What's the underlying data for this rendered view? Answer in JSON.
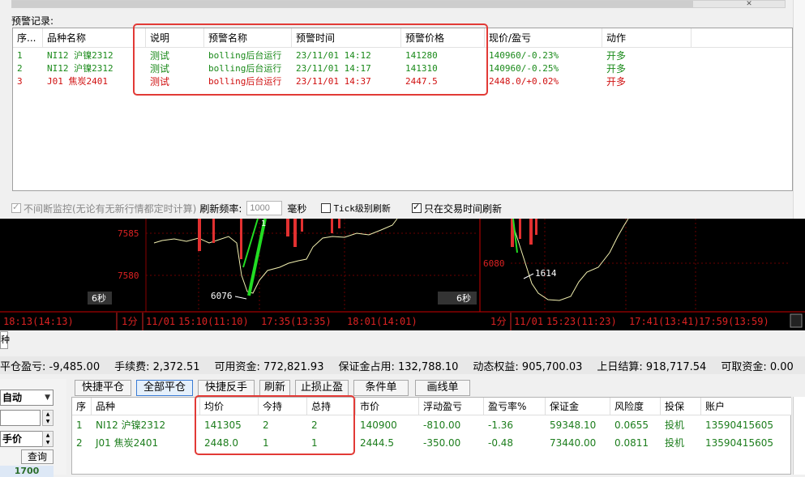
{
  "dialog": {
    "section_title": "预警记录:",
    "close_glyph": "✕"
  },
  "alert_table": {
    "columns": [
      "序...",
      "品种名称",
      "说明",
      "预警名称",
      "预警时间",
      "预警价格",
      "现价/盈亏",
      "动作"
    ],
    "rows": [
      {
        "idx": "1",
        "name": "NI12 沪镍2312",
        "note": "测试",
        "alert": "bolling后台运行",
        "time": "23/11/01 14:12",
        "price": "141280",
        "pnl": "140960/-0.23%",
        "action": "开多",
        "color": "#1a8a1a"
      },
      {
        "idx": "2",
        "name": "NI12 沪镍2312",
        "note": "测试",
        "alert": "bolling后台运行",
        "time": "23/11/01 14:17",
        "price": "141310",
        "pnl": "140960/-0.25%",
        "action": "开多",
        "color": "#1a8a1a"
      },
      {
        "idx": "3",
        "name": "J01 焦炭2401",
        "note": "测试",
        "alert": "bolling后台运行",
        "time": "23/11/01 14:37",
        "price": "2447.5",
        "pnl": "2448.0/+0.02%",
        "action": "开多",
        "color": "#d01010"
      }
    ]
  },
  "options": {
    "continuous_label": "不间断监控(无论有无新行情都定时计算)",
    "refresh_label": "刷新频率:",
    "refresh_value": "1000",
    "refresh_unit": "毫秒",
    "tick_label": "Tick级别刷新",
    "trading_only_label": "只在交易时间刷新"
  },
  "chart": {
    "left_pane": {
      "price_labels": [
        "7585",
        "7580"
      ],
      "low_label": "6076",
      "mark_label": "1",
      "period_badge": "6秒",
      "time_axis_left": "18:13(14:13)",
      "period_tag": "1分",
      "time_axis": [
        "11/01",
        "15:10(11:10)",
        "17:35(13:35)",
        "18:01(14:01)"
      ]
    },
    "right_pane": {
      "price_labels": [
        "6080"
      ],
      "value_label": "1614",
      "period_badge": "6秒",
      "period_tag": "1分",
      "time_axis": [
        "11/01",
        "15:23(11:23)",
        "17:41(13:41)",
        "17:59(13:59)"
      ]
    },
    "tab_label": "种"
  },
  "summary": {
    "items": [
      "平仓盈亏: -9,485.00",
      "手续费: 2,372.51",
      "可用资金: 772,821.93",
      "保证金占用: 132,788.10",
      "动态权益: 905,700.03",
      "上日结算: 918,717.54",
      "可取资金: 0.00"
    ]
  },
  "left_panel": {
    "mode_select": "自动",
    "price_select": "手价",
    "query_label": "查询",
    "bottom_value": "1700"
  },
  "toolbar": {
    "buttons": [
      "快捷平仓",
      "全部平仓",
      "快捷反手",
      "刷新",
      "止损止盈",
      "条件单",
      "画线单"
    ]
  },
  "positions": {
    "columns": [
      "序",
      "品种",
      "均价",
      "今持",
      "总持",
      "市价",
      "浮动盈亏",
      "盈亏率%",
      "保证金",
      "风险度",
      "投保",
      "账户"
    ],
    "rows": [
      {
        "idx": "1",
        "name": "NI12 沪镍2312",
        "avg": "141305",
        "today": "2",
        "total": "2",
        "market": "140900",
        "float_pnl": "-810.00",
        "pnl_rate": "-1.36",
        "margin": "59348.10",
        "risk": "0.0655",
        "hedge": "投机",
        "account": "13590415605"
      },
      {
        "idx": "2",
        "name": "J01 焦炭2401",
        "avg": "2448.0",
        "today": "1",
        "total": "1",
        "market": "2444.5",
        "float_pnl": "-350.00",
        "pnl_rate": "-0.48",
        "margin": "73440.00",
        "risk": "0.0811",
        "hedge": "投机",
        "account": "13590415605"
      }
    ]
  }
}
